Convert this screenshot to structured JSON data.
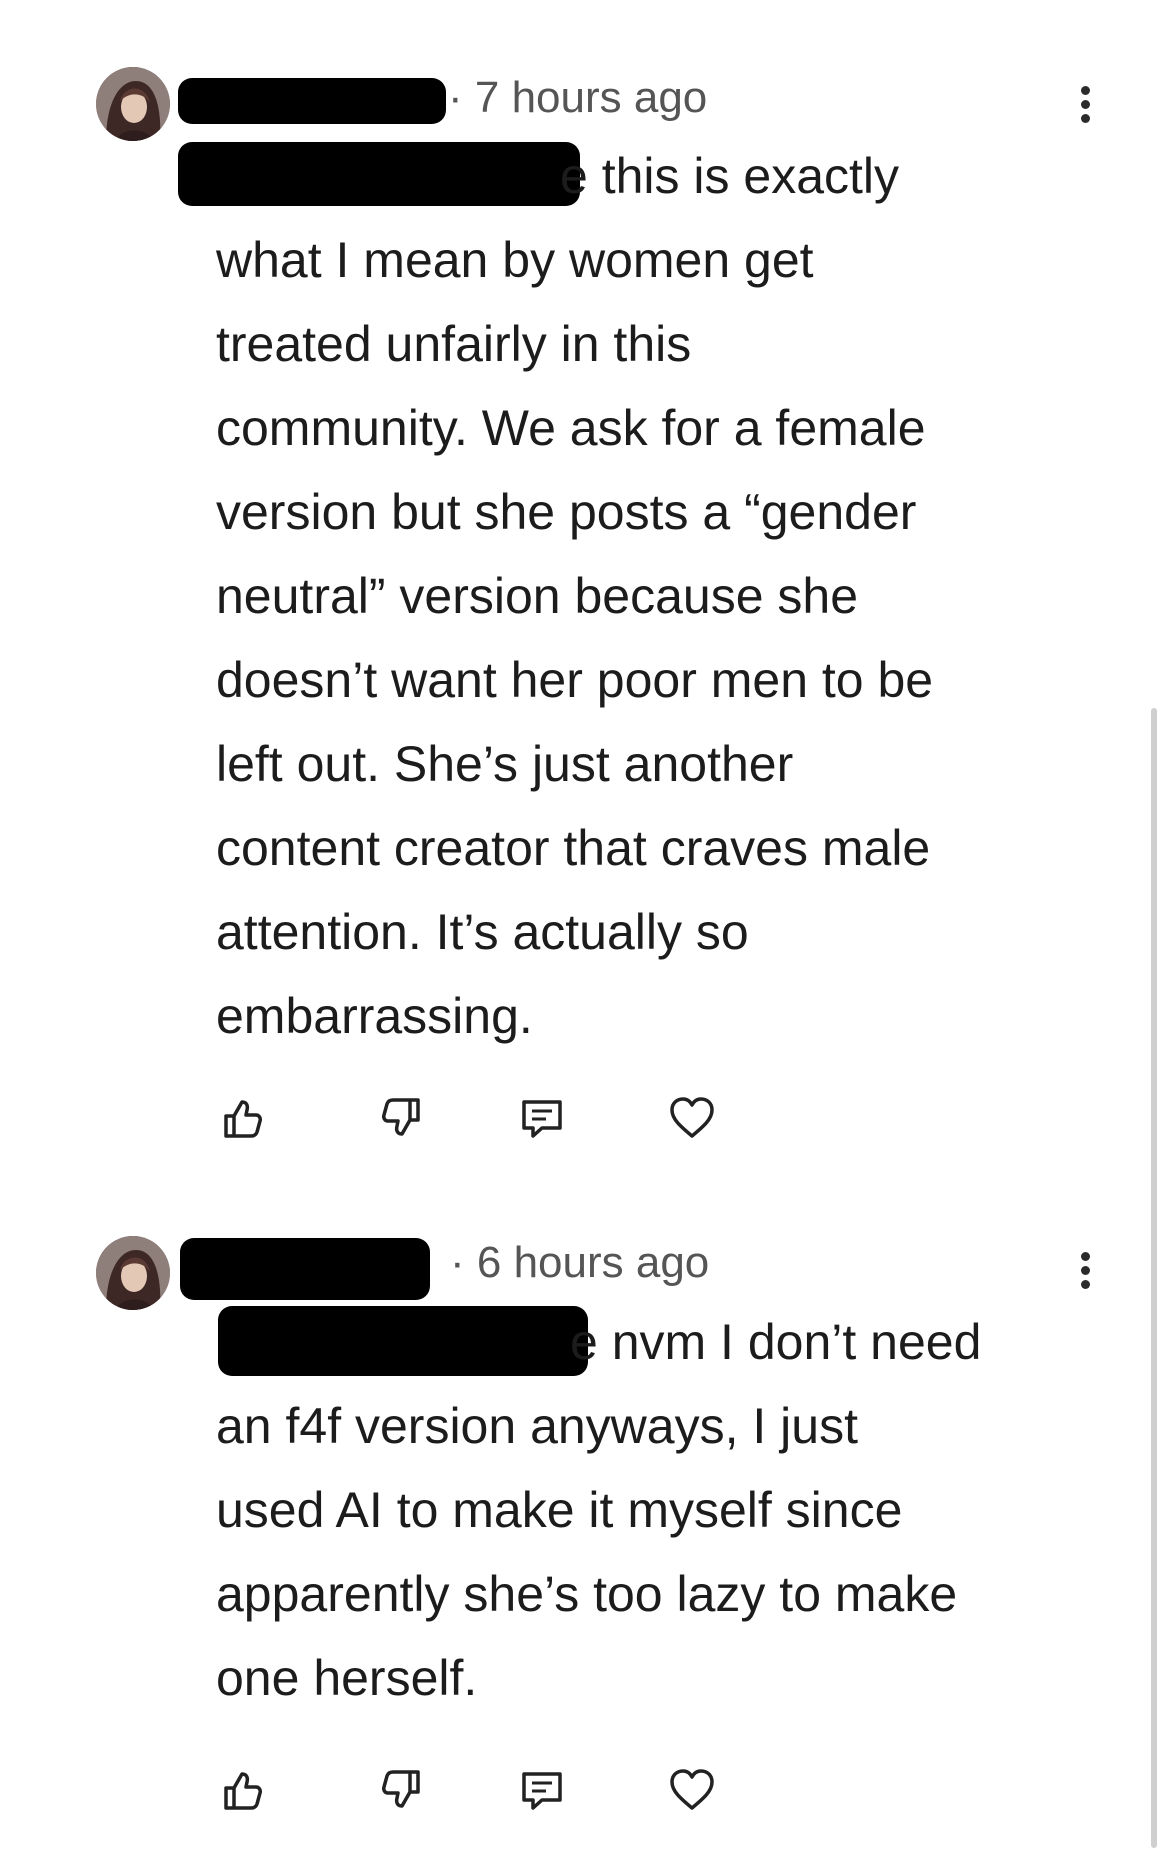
{
  "comments": [
    {
      "timestamp": "· 7 hours ago",
      "first_line": "e this is exactly",
      "body": "what I mean by women get\ntreated unfairly in this\ncommunity. We ask for a female\nversion but she posts a “gender\nneutral” version because she\ndoesn’t want her poor men to be\nleft out. She’s just another\ncontent creator that craves male\nattention. It’s actually so\nembarrassing."
    },
    {
      "timestamp": "· 6 hours ago",
      "first_line": "e nvm I don’t need",
      "body": "an f4f version anyways, I just\nused AI to make it myself since\napparently she’s too lazy to make\none herself."
    }
  ],
  "icons": {
    "avatar": "avatar",
    "more": "more-vertical-icon",
    "like": "thumbs-up-icon",
    "dislike": "thumbs-down-icon",
    "reply": "comment-icon",
    "heart": "heart-icon"
  },
  "colors": {
    "text": "#1c1c1c",
    "meta": "#555555",
    "icon": "#222222",
    "scrollbar": "#cfcfcf",
    "redaction": "#000000"
  }
}
